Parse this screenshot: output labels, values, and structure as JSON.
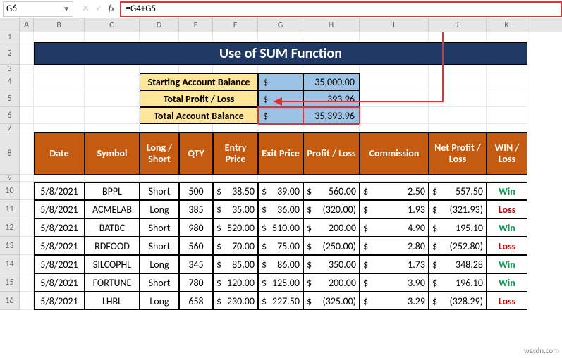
{
  "nameBox": "G6",
  "formula": "=G4+G5",
  "columns": [
    "A",
    "B",
    "C",
    "D",
    "E",
    "F",
    "G",
    "H",
    "I",
    "J",
    "K"
  ],
  "rowNums": [
    1,
    2,
    3,
    4,
    5,
    6,
    7,
    8,
    9,
    10,
    11,
    12,
    13,
    14,
    15,
    16
  ],
  "title": "Use of SUM Function",
  "summary": [
    {
      "label": "Starting Account Balance",
      "dollar": "$",
      "value": "35,000.00"
    },
    {
      "label": "Total Profit / Loss",
      "dollar": "$",
      "value": "393.96"
    },
    {
      "label": "Total Account Balance",
      "dollar": "$",
      "value": "35,393.96"
    }
  ],
  "headers": [
    "Date",
    "Symbol",
    "Long / Short",
    "QTY",
    "Entry Price",
    "Exit Price",
    "Profit / Loss",
    "Commission",
    "Net Profit / Loss",
    "WIN / Loss"
  ],
  "rows": [
    {
      "date": "5/8/2021",
      "sym": "BPPL",
      "ls": "Short",
      "qty": "500",
      "entry": "38.50",
      "exit": "39.00",
      "pl": "560.00",
      "plneg": false,
      "comm": "2.50",
      "net": "557.50",
      "netneg": false,
      "wl": "Win"
    },
    {
      "date": "5/8/2021",
      "sym": "ACMELAB",
      "ls": "Long",
      "qty": "385",
      "entry": "35.00",
      "exit": "36.00",
      "pl": "(320.00)",
      "plneg": true,
      "comm": "1.93",
      "net": "(321.93)",
      "netneg": true,
      "wl": "Loss"
    },
    {
      "date": "5/8/2021",
      "sym": "BATBC",
      "ls": "Short",
      "qty": "980",
      "entry": "520.00",
      "exit": "510.00",
      "pl": "200.00",
      "plneg": false,
      "comm": "4.90",
      "net": "195.10",
      "netneg": false,
      "wl": "Win"
    },
    {
      "date": "5/8/2021",
      "sym": "RDFOOD",
      "ls": "Short",
      "qty": "560",
      "entry": "70.00",
      "exit": "75.00",
      "pl": "(250.00)",
      "plneg": true,
      "comm": "2.80",
      "net": "(252.80)",
      "netneg": true,
      "wl": "Loss"
    },
    {
      "date": "5/8/2021",
      "sym": "SILCOPHL",
      "ls": "Long",
      "qty": "345",
      "entry": "85.00",
      "exit": "86.00",
      "pl": "350.00",
      "plneg": false,
      "comm": "1.73",
      "net": "348.28",
      "netneg": false,
      "wl": "Win"
    },
    {
      "date": "5/8/2021",
      "sym": "FORTUNE",
      "ls": "Short",
      "qty": "780",
      "entry": "120.00",
      "exit": "125.00",
      "pl": "200.00",
      "plneg": false,
      "comm": "3.90",
      "net": "196.10",
      "netneg": false,
      "wl": "Win"
    },
    {
      "date": "5/8/2021",
      "sym": "LHBL",
      "ls": "Long",
      "qty": "658",
      "entry": "230.00",
      "exit": "227.50",
      "pl": "(325.00)",
      "plneg": true,
      "comm": "3.29",
      "net": "(328.29)",
      "netneg": true,
      "wl": "Loss"
    }
  ],
  "watermark": "wsxdn.com"
}
